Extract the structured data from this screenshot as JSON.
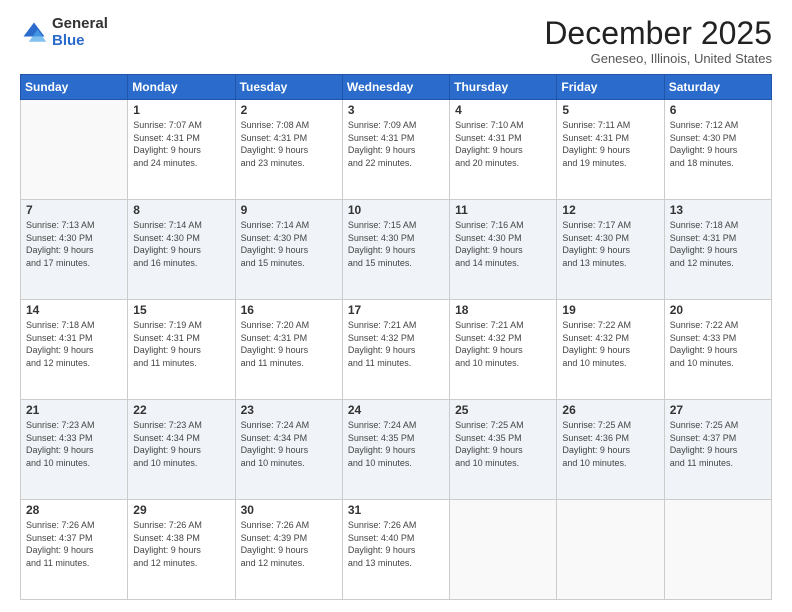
{
  "logo": {
    "general": "General",
    "blue": "Blue"
  },
  "header": {
    "month": "December 2025",
    "location": "Geneseo, Illinois, United States"
  },
  "weekdays": [
    "Sunday",
    "Monday",
    "Tuesday",
    "Wednesday",
    "Thursday",
    "Friday",
    "Saturday"
  ],
  "weeks": [
    [
      {
        "day": "",
        "info": ""
      },
      {
        "day": "1",
        "info": "Sunrise: 7:07 AM\nSunset: 4:31 PM\nDaylight: 9 hours\nand 24 minutes."
      },
      {
        "day": "2",
        "info": "Sunrise: 7:08 AM\nSunset: 4:31 PM\nDaylight: 9 hours\nand 23 minutes."
      },
      {
        "day": "3",
        "info": "Sunrise: 7:09 AM\nSunset: 4:31 PM\nDaylight: 9 hours\nand 22 minutes."
      },
      {
        "day": "4",
        "info": "Sunrise: 7:10 AM\nSunset: 4:31 PM\nDaylight: 9 hours\nand 20 minutes."
      },
      {
        "day": "5",
        "info": "Sunrise: 7:11 AM\nSunset: 4:31 PM\nDaylight: 9 hours\nand 19 minutes."
      },
      {
        "day": "6",
        "info": "Sunrise: 7:12 AM\nSunset: 4:30 PM\nDaylight: 9 hours\nand 18 minutes."
      }
    ],
    [
      {
        "day": "7",
        "info": "Sunrise: 7:13 AM\nSunset: 4:30 PM\nDaylight: 9 hours\nand 17 minutes."
      },
      {
        "day": "8",
        "info": "Sunrise: 7:14 AM\nSunset: 4:30 PM\nDaylight: 9 hours\nand 16 minutes."
      },
      {
        "day": "9",
        "info": "Sunrise: 7:14 AM\nSunset: 4:30 PM\nDaylight: 9 hours\nand 15 minutes."
      },
      {
        "day": "10",
        "info": "Sunrise: 7:15 AM\nSunset: 4:30 PM\nDaylight: 9 hours\nand 15 minutes."
      },
      {
        "day": "11",
        "info": "Sunrise: 7:16 AM\nSunset: 4:30 PM\nDaylight: 9 hours\nand 14 minutes."
      },
      {
        "day": "12",
        "info": "Sunrise: 7:17 AM\nSunset: 4:30 PM\nDaylight: 9 hours\nand 13 minutes."
      },
      {
        "day": "13",
        "info": "Sunrise: 7:18 AM\nSunset: 4:31 PM\nDaylight: 9 hours\nand 12 minutes."
      }
    ],
    [
      {
        "day": "14",
        "info": "Sunrise: 7:18 AM\nSunset: 4:31 PM\nDaylight: 9 hours\nand 12 minutes."
      },
      {
        "day": "15",
        "info": "Sunrise: 7:19 AM\nSunset: 4:31 PM\nDaylight: 9 hours\nand 11 minutes."
      },
      {
        "day": "16",
        "info": "Sunrise: 7:20 AM\nSunset: 4:31 PM\nDaylight: 9 hours\nand 11 minutes."
      },
      {
        "day": "17",
        "info": "Sunrise: 7:21 AM\nSunset: 4:32 PM\nDaylight: 9 hours\nand 11 minutes."
      },
      {
        "day": "18",
        "info": "Sunrise: 7:21 AM\nSunset: 4:32 PM\nDaylight: 9 hours\nand 10 minutes."
      },
      {
        "day": "19",
        "info": "Sunrise: 7:22 AM\nSunset: 4:32 PM\nDaylight: 9 hours\nand 10 minutes."
      },
      {
        "day": "20",
        "info": "Sunrise: 7:22 AM\nSunset: 4:33 PM\nDaylight: 9 hours\nand 10 minutes."
      }
    ],
    [
      {
        "day": "21",
        "info": "Sunrise: 7:23 AM\nSunset: 4:33 PM\nDaylight: 9 hours\nand 10 minutes."
      },
      {
        "day": "22",
        "info": "Sunrise: 7:23 AM\nSunset: 4:34 PM\nDaylight: 9 hours\nand 10 minutes."
      },
      {
        "day": "23",
        "info": "Sunrise: 7:24 AM\nSunset: 4:34 PM\nDaylight: 9 hours\nand 10 minutes."
      },
      {
        "day": "24",
        "info": "Sunrise: 7:24 AM\nSunset: 4:35 PM\nDaylight: 9 hours\nand 10 minutes."
      },
      {
        "day": "25",
        "info": "Sunrise: 7:25 AM\nSunset: 4:35 PM\nDaylight: 9 hours\nand 10 minutes."
      },
      {
        "day": "26",
        "info": "Sunrise: 7:25 AM\nSunset: 4:36 PM\nDaylight: 9 hours\nand 10 minutes."
      },
      {
        "day": "27",
        "info": "Sunrise: 7:25 AM\nSunset: 4:37 PM\nDaylight: 9 hours\nand 11 minutes."
      }
    ],
    [
      {
        "day": "28",
        "info": "Sunrise: 7:26 AM\nSunset: 4:37 PM\nDaylight: 9 hours\nand 11 minutes."
      },
      {
        "day": "29",
        "info": "Sunrise: 7:26 AM\nSunset: 4:38 PM\nDaylight: 9 hours\nand 12 minutes."
      },
      {
        "day": "30",
        "info": "Sunrise: 7:26 AM\nSunset: 4:39 PM\nDaylight: 9 hours\nand 12 minutes."
      },
      {
        "day": "31",
        "info": "Sunrise: 7:26 AM\nSunset: 4:40 PM\nDaylight: 9 hours\nand 13 minutes."
      },
      {
        "day": "",
        "info": ""
      },
      {
        "day": "",
        "info": ""
      },
      {
        "day": "",
        "info": ""
      }
    ]
  ]
}
